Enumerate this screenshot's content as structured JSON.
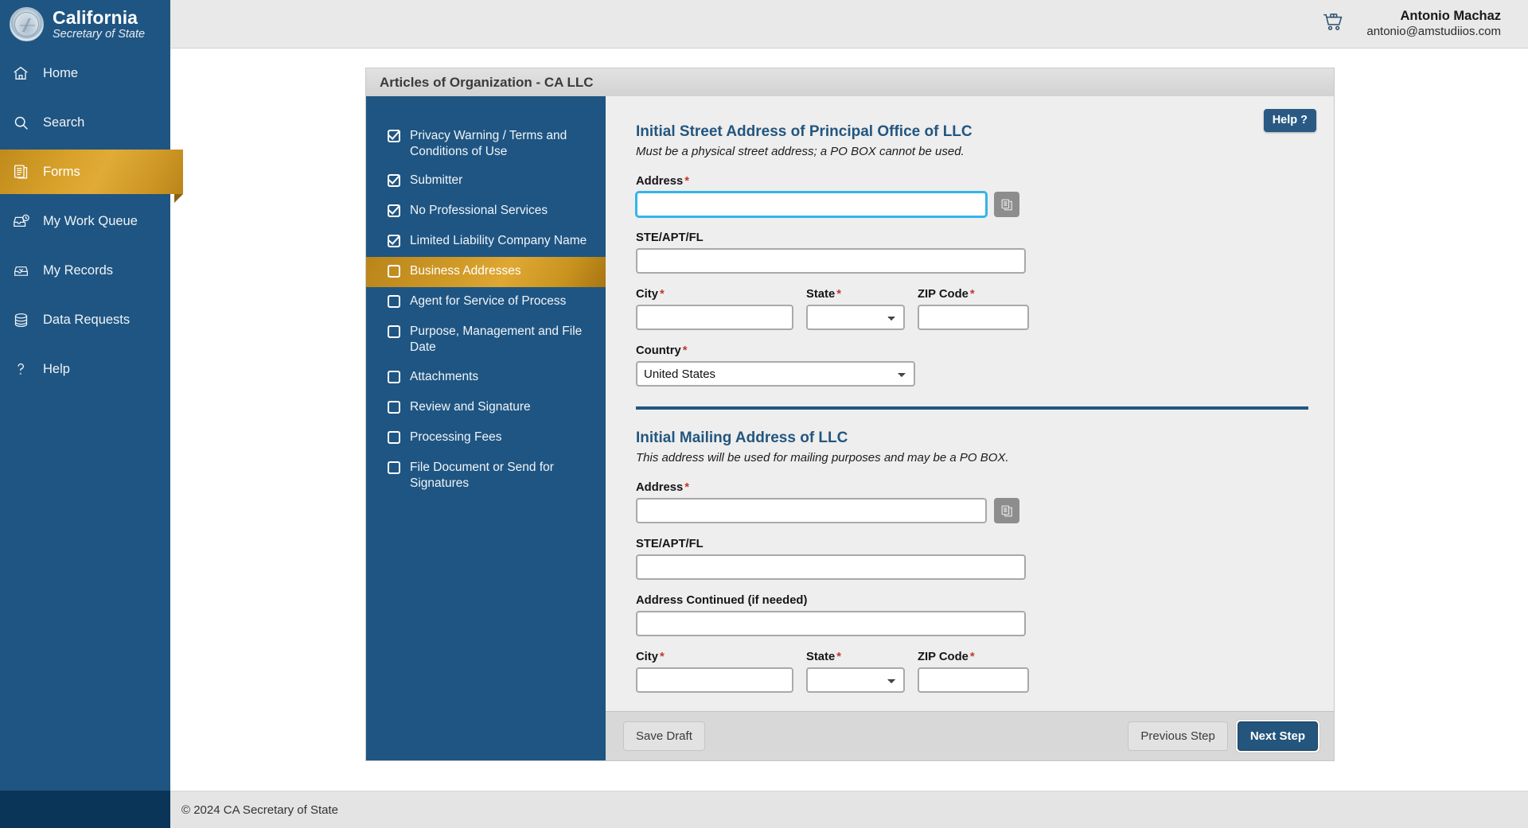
{
  "brand": {
    "line1": "California",
    "line2": "Secretary of State",
    "seal_icon": "california-state-seal"
  },
  "sidebar": {
    "items": [
      {
        "label": "Home",
        "icon": "home-icon",
        "active": false
      },
      {
        "label": "Search",
        "icon": "search-icon",
        "active": false
      },
      {
        "label": "Forms",
        "icon": "forms-icon",
        "active": true
      },
      {
        "label": "My Work Queue",
        "icon": "work-queue-icon",
        "active": false
      },
      {
        "label": "My Records",
        "icon": "records-inbox-icon",
        "active": false
      },
      {
        "label": "Data Requests",
        "icon": "database-icon",
        "active": false
      },
      {
        "label": "Help",
        "icon": "question-mark-icon",
        "active": false
      }
    ]
  },
  "topbar": {
    "cart_icon": "shopping-cart-icon",
    "user_name": "Antonio Machaz",
    "user_email": "antonio@amstudiios.com"
  },
  "card": {
    "title": "Articles of Organization - CA LLC"
  },
  "steps": [
    {
      "label": "Privacy Warning / Terms and Conditions of Use",
      "state": "done"
    },
    {
      "label": "Submitter",
      "state": "done"
    },
    {
      "label": "No Professional Services",
      "state": "done"
    },
    {
      "label": "Limited Liability Company Name",
      "state": "done"
    },
    {
      "label": "Business Addresses",
      "state": "current"
    },
    {
      "label": "Agent for Service of Process",
      "state": "todo"
    },
    {
      "label": "Purpose, Management and File Date",
      "state": "todo"
    },
    {
      "label": "Attachments",
      "state": "todo"
    },
    {
      "label": "Review and Signature",
      "state": "todo"
    },
    {
      "label": "Processing Fees",
      "state": "todo"
    },
    {
      "label": "File Document or Send for Signatures",
      "state": "todo"
    }
  ],
  "help_badge": "Help ?",
  "section1": {
    "title": "Initial Street Address of Principal Office of LLC",
    "subtitle": "Must be a physical street address; a PO BOX cannot be used.",
    "address_label": "Address",
    "address_value": "",
    "address_placeholder": "",
    "copy_icon": "copy-address-icon",
    "ste_label": "STE/APT/FL",
    "ste_value": "",
    "city_label": "City",
    "city_value": "",
    "state_label": "State",
    "state_value": "",
    "zip_label": "ZIP Code",
    "zip_value": "",
    "country_label": "Country",
    "country_value": "United States"
  },
  "section2": {
    "title": "Initial Mailing Address of LLC",
    "subtitle": "This address will be used for mailing purposes and may be a PO BOX.",
    "address_label": "Address",
    "address_value": "",
    "copy_icon": "copy-address-icon",
    "ste_label": "STE/APT/FL",
    "ste_value": "",
    "cont_label": "Address Continued (if needed)",
    "cont_value": "",
    "city_label": "City",
    "city_value": "",
    "state_label": "State",
    "state_value": "",
    "zip_label": "ZIP Code",
    "zip_value": ""
  },
  "actions": {
    "save_draft": "Save Draft",
    "previous_step": "Previous Step",
    "next_step": "Next Step"
  },
  "footer": {
    "copyright": "© 2024 CA Secretary of State"
  },
  "colors": {
    "sidebar_blue": "#1f5582",
    "accent_gold": "#d09a27",
    "heading_blue": "#23567f",
    "focus_cyan": "#33b5e8",
    "required_red": "#c0392b"
  }
}
